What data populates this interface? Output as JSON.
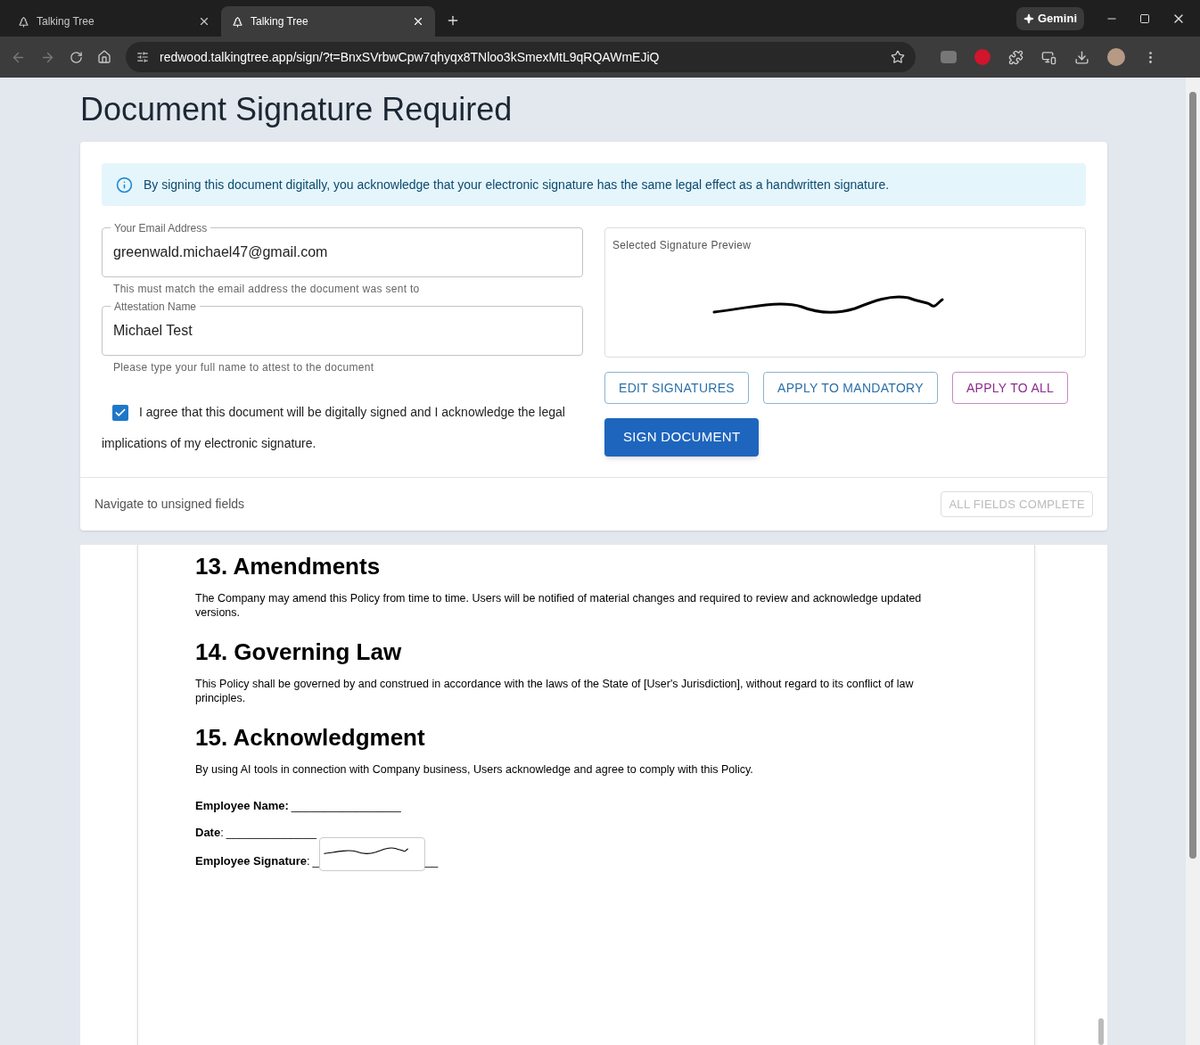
{
  "browser": {
    "tabs": [
      {
        "title": "Talking Tree",
        "selected": false
      },
      {
        "title": "Talking Tree",
        "selected": true
      }
    ],
    "url": "redwood.talkingtree.app/sign/?t=BnxSVrbwCpw7qhyqx8TNloo3kSmexMtL9qRQAWmEJiQ",
    "gemini": "Gemini"
  },
  "title": "Document Signature Required",
  "notice": "By signing this document digitally, you acknowledge that your electronic signature has the same legal effect as a handwritten signature.",
  "fields": [
    {
      "label": "Your Email Address",
      "value": "greenwald.michael47@gmail.com",
      "helper": "This must match the email address the document was sent to"
    },
    {
      "label": "Attestation Name",
      "value": "Michael Test",
      "helper": "Please type your full name to attest to the document"
    }
  ],
  "agreement": {
    "checked": true,
    "text": "I agree that this document will be digitally signed and I acknowledge the legal implications of my electronic signature."
  },
  "preview": {
    "label": "Selected Signature Preview"
  },
  "buttons": [
    {
      "label": "EDIT SIGNATURES",
      "kind": "outlined"
    },
    {
      "label": "APPLY TO MANDATORY",
      "kind": "outlined"
    },
    {
      "label": "APPLY TO ALL",
      "kind": "outlined-secondary"
    },
    {
      "label": "SIGN DOCUMENT",
      "kind": "contained"
    }
  ],
  "footer": {
    "navigate": "Navigate to unsigned fields",
    "status": "ALL FIELDS COMPLETE",
    "status_disabled": true
  },
  "document": {
    "sections": [
      {
        "heading": "13. Amendments",
        "text": "The Company may amend this Policy from time to time. Users will be notified of material changes and required to review and acknowledge updated versions."
      },
      {
        "heading": "14. Governing Law",
        "text": "This Policy shall be governed by and construed in accordance with the laws of the State of [User's Jurisdiction], without regard to its conflict of law principles."
      },
      {
        "heading": "15. Acknowledgment",
        "text": "By using AI tools in connection with Company business, Users acknowledge and agree to comply with this Policy."
      }
    ],
    "lines": [
      {
        "kind": "text",
        "label": "**Employee Name:**",
        "blank": "_________________"
      },
      {
        "kind": "text",
        "label": "**Date**:",
        "blank": "______________"
      },
      {
        "kind": "signature",
        "label": "**Employee Signature**:",
        "blank": "_",
        "blank_after": "__"
      }
    ]
  }
}
